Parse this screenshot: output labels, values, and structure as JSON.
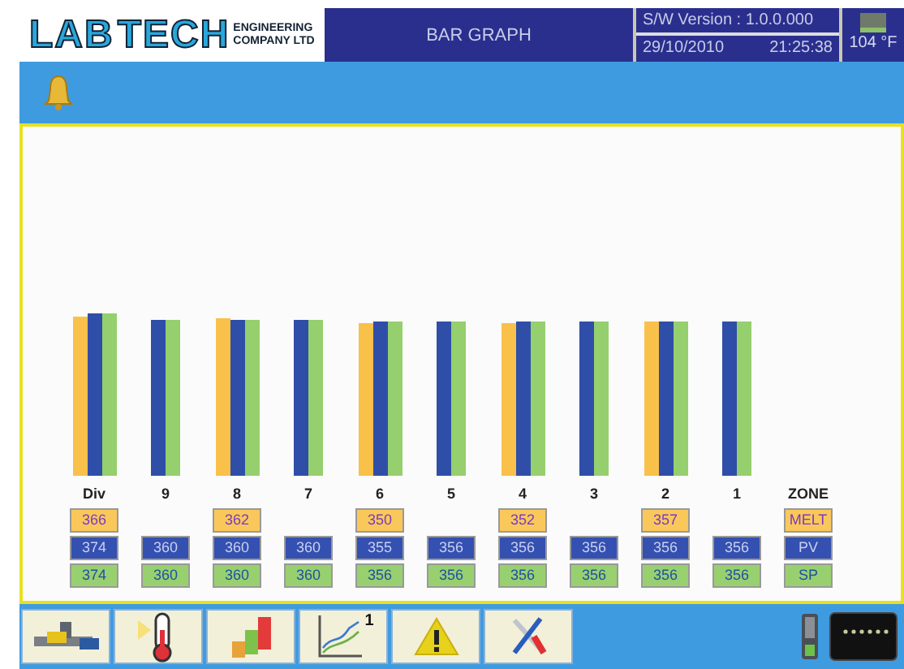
{
  "header": {
    "logo": {
      "main_1": "LAB",
      "main_2": "TECH",
      "sub_1": "ENGINEERING",
      "sub_2": "COMPANY LTD"
    },
    "title": "BAR GRAPH",
    "version": "S/W Version : 1.0.0.000",
    "date": "29/10/2010",
    "time": "21:25:38",
    "temperature": "104 °F"
  },
  "zones": [
    {
      "label": "Div",
      "melt": "366",
      "pv": "374",
      "sp": "374"
    },
    {
      "label": "9",
      "pv": "360",
      "sp": "360"
    },
    {
      "label": "8",
      "melt": "362",
      "pv": "360",
      "sp": "360"
    },
    {
      "label": "7",
      "pv": "360",
      "sp": "360"
    },
    {
      "label": "6",
      "melt": "350",
      "pv": "355",
      "sp": "356"
    },
    {
      "label": "5",
      "pv": "356",
      "sp": "356"
    },
    {
      "label": "4",
      "melt": "352",
      "pv": "356",
      "sp": "356"
    },
    {
      "label": "3",
      "pv": "356",
      "sp": "356"
    },
    {
      "label": "2",
      "melt": "357",
      "pv": "356",
      "sp": "356"
    },
    {
      "label": "1",
      "pv": "356",
      "sp": "356"
    }
  ],
  "legend": {
    "zone": "ZONE",
    "melt": "MELT",
    "pv": "PV",
    "sp": "SP"
  },
  "toolbar": [
    {
      "kind": "machine"
    },
    {
      "kind": "thermometer"
    },
    {
      "kind": "bars"
    },
    {
      "kind": "trend",
      "badge": "1"
    },
    {
      "kind": "warning"
    },
    {
      "kind": "tools"
    }
  ]
}
